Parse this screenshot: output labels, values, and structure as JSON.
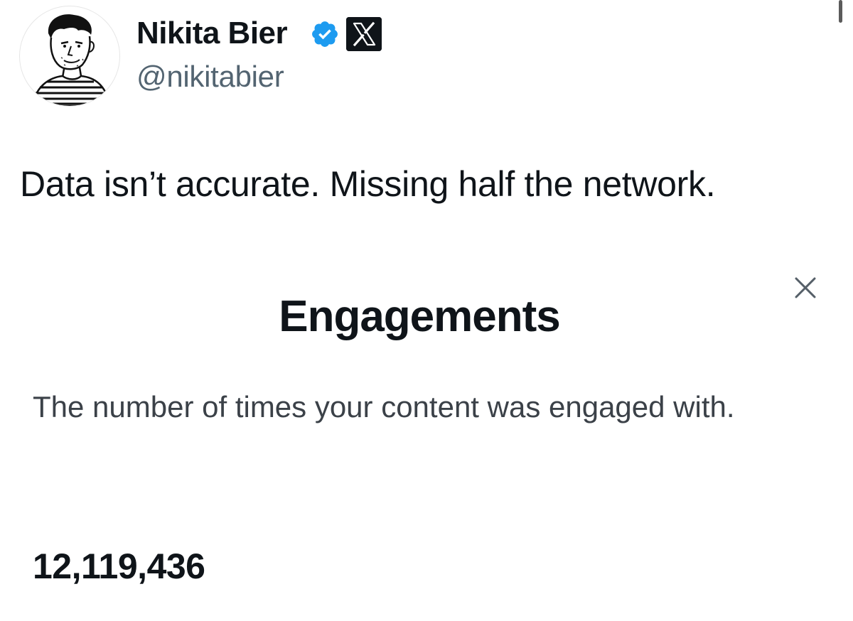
{
  "tweet": {
    "author_name": "Nikita Bier",
    "author_handle": "@nikitabier",
    "verified_icon": "verified-badge-icon",
    "affiliation_icon": "x-logo-icon",
    "text": "Data isn’t accurate. Missing half the network."
  },
  "embedded_screenshot": {
    "title": "Engagements",
    "description": "The number of times your content was engaged with.",
    "value": "12,119,436",
    "close_icon": "close-icon"
  },
  "colors": {
    "text_primary": "#0f1419",
    "text_secondary": "#536471",
    "verified_blue": "#1d9bf0"
  }
}
